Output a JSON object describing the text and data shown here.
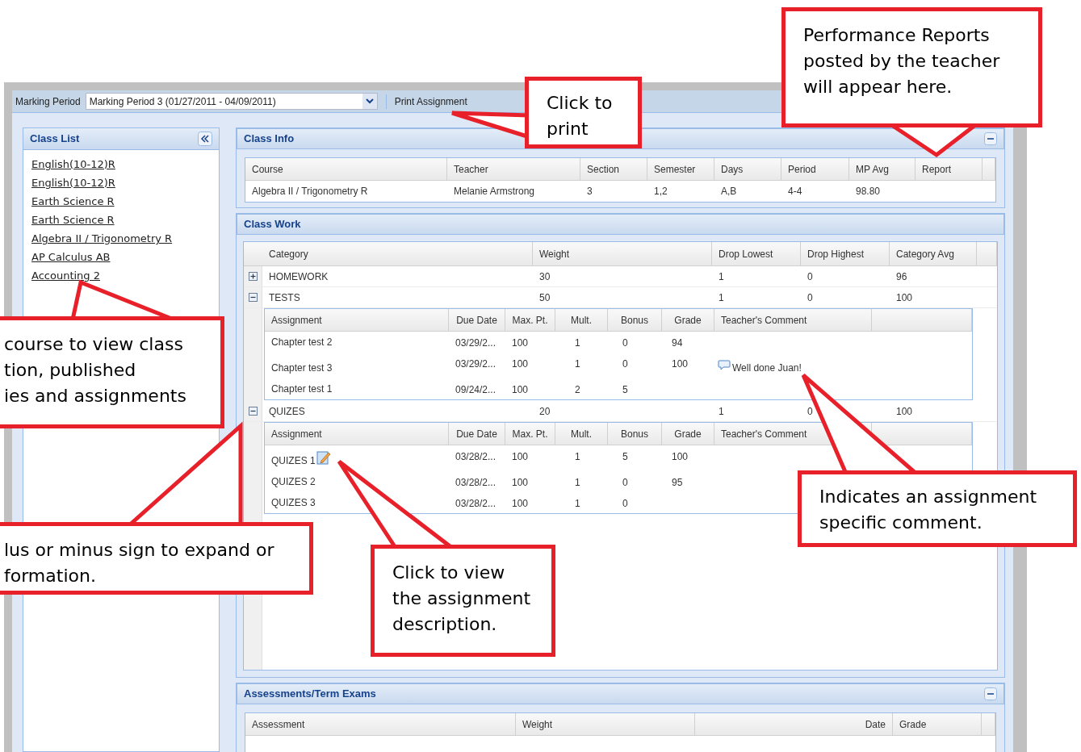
{
  "toolbar": {
    "marking_period_label": "Marking Period",
    "marking_period_value": "Marking Period 3 (01/27/2011 - 04/09/2011)",
    "print_button": "Print Assignment"
  },
  "class_list": {
    "title": "Class List",
    "items": [
      "English(10-12)R",
      "English(10-12)R",
      "Earth Science R",
      "Earth Science R",
      "Algebra II / Trigonometry R",
      "AP Calculus AB",
      "Accounting 2"
    ]
  },
  "class_info": {
    "title": "Class Info",
    "columns": [
      "Course",
      "Teacher",
      "Section",
      "Semester",
      "Days",
      "Period",
      "MP Avg",
      "Report"
    ],
    "row": [
      "Algebra II / Trigonometry R",
      "Melanie Armstrong",
      "3",
      "1,2",
      "A,B",
      "4-4",
      "98.80"
    ]
  },
  "class_work": {
    "title": "Class Work",
    "columns": [
      "Category",
      "Weight",
      "Drop Lowest",
      "Drop Highest",
      "Category Avg"
    ],
    "categories": [
      {
        "name": "HOMEWORK",
        "weight": "30",
        "drop_lowest": "1",
        "drop_highest": "0",
        "average": "96",
        "expanded": false
      },
      {
        "name": "TESTS",
        "weight": "50",
        "drop_lowest": "1",
        "drop_highest": "0",
        "average": "100",
        "expanded": true,
        "assignment_columns": [
          "Assignment",
          "Due Date",
          "Max. Pt.",
          "Mult.",
          "Bonus",
          "Grade",
          "Teacher's Comment"
        ],
        "assignments": [
          {
            "name": "Chapter test 2",
            "due_date": "03/29/2...",
            "max_pt": "100",
            "mult": "1",
            "bonus": "0",
            "grade": "94",
            "has_description": false
          },
          {
            "name": "Chapter test 3",
            "due_date": "03/29/2...",
            "max_pt": "100",
            "mult": "1",
            "bonus": "0",
            "grade": "100",
            "comment": "Well done Juan!",
            "has_description": false
          },
          {
            "name": "Chapter test 1",
            "due_date": "09/24/2...",
            "max_pt": "100",
            "mult": "2",
            "bonus": "5",
            "has_description": false
          }
        ]
      },
      {
        "name": "QUIZES",
        "weight": "20",
        "drop_lowest": "1",
        "drop_highest": "0",
        "average": "100",
        "expanded": true,
        "assignment_columns": [
          "Assignment",
          "Due Date",
          "Max. Pt.",
          "Mult.",
          "Bonus",
          "Grade",
          "Teacher's Comment"
        ],
        "assignments": [
          {
            "name": "QUIZES 1",
            "due_date": "03/28/2...",
            "max_pt": "100",
            "mult": "1",
            "bonus": "5",
            "grade": "100",
            "has_description": true
          },
          {
            "name": "QUIZES 2",
            "due_date": "03/28/2...",
            "max_pt": "100",
            "mult": "1",
            "bonus": "0",
            "grade": "95",
            "has_description": false
          },
          {
            "name": "QUIZES 3",
            "due_date": "03/28/2...",
            "max_pt": "100",
            "mult": "1",
            "bonus": "0",
            "has_description": false
          }
        ]
      }
    ]
  },
  "assessments": {
    "title": "Assessments/Term Exams",
    "columns": [
      "Assessment",
      "Weight",
      "Date",
      "Grade"
    ]
  },
  "callouts": [
    {
      "text": "Click to\nprint"
    },
    {
      "text": "Performance Reports\nposted by the teacher\nwill appear here."
    },
    {
      "text": "course to view class\ntion, published\nies and assignments"
    },
    {
      "text": "lus or minus sign to expand or\nformation."
    },
    {
      "text": "Click to view\nthe assignment\ndescription."
    },
    {
      "text": "Indicates an assignment\nspecific comment."
    }
  ]
}
